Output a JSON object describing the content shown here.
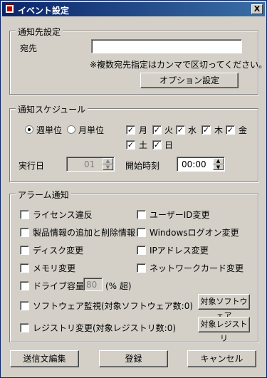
{
  "window": {
    "title": "イベント設定",
    "close_glyph": "X"
  },
  "notify": {
    "legend": "通知先設定",
    "to_label": "宛先",
    "to_value": "",
    "hint": "※複数宛先指定はカンマで区切ってください。",
    "options_button": "オプション設定"
  },
  "schedule": {
    "legend": "通知スケジュール",
    "weekly_label": "週単位",
    "monthly_label": "月単位",
    "mode": "weekly",
    "days": [
      {
        "label": "月",
        "checked": true
      },
      {
        "label": "火",
        "checked": true
      },
      {
        "label": "水",
        "checked": true
      },
      {
        "label": "木",
        "checked": true
      },
      {
        "label": "金",
        "checked": true
      },
      {
        "label": "土",
        "checked": true
      },
      {
        "label": "日",
        "checked": true
      }
    ],
    "exec_day_label": "実行日",
    "exec_day_value": "01",
    "start_time_label": "開始時刻",
    "start_time_value": "00:00"
  },
  "alarm": {
    "legend": "アラーム通知",
    "license": "ライセンス違反",
    "user_id": "ユーザーID変更",
    "product_info": "製品情報の追加と削除情報",
    "windows_logon": "Windowsログオン変更",
    "disk": "ディスク変更",
    "ip": "IPアドレス変更",
    "memory": "メモリ変更",
    "network": "ネットワークカード変更",
    "drive": "ドライブ容量",
    "drive_value": "80",
    "drive_unit": "(% 超)",
    "software_watch": "ソフトウェア監視(対象ソフトウェア数:0)",
    "target_software_button": "対象ソフトウェア",
    "registry": "レジストリ変更(対象レジストリ数:0)",
    "target_registry_button": "対象レジストリ"
  },
  "footer": {
    "edit_message": "送信文編集",
    "register": "登録",
    "cancel": "キャンセル"
  }
}
